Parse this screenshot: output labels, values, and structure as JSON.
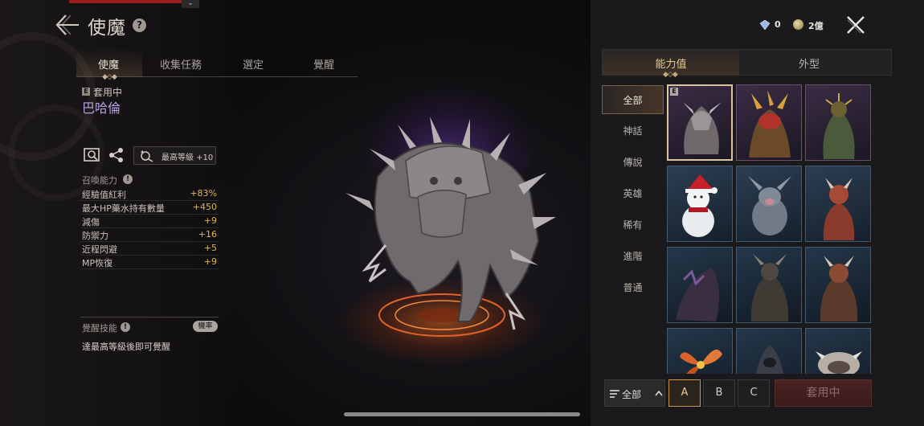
{
  "header": {
    "title": "使魔",
    "help_glyph": "?",
    "dropdown_glyph": "⌄"
  },
  "tabs": [
    {
      "label": "使魔",
      "active": true
    },
    {
      "label": "收集任務",
      "active": false
    },
    {
      "label": "選定",
      "active": false
    },
    {
      "label": "覺醒",
      "active": false
    }
  ],
  "current": {
    "badge": "E",
    "status": "套用中",
    "name": "巴哈倫",
    "level_label": "最高等級 +10"
  },
  "summon_stats": {
    "label": "召喚能力",
    "info_glyph": "!",
    "rows": [
      {
        "name": "經驗值紅利",
        "value": "+83%"
      },
      {
        "name": "最大HP藥水持有數量",
        "value": "+450"
      },
      {
        "name": "減傷",
        "value": "+9"
      },
      {
        "name": "防禦力",
        "value": "+16"
      },
      {
        "name": "近程閃避",
        "value": "+5"
      },
      {
        "name": "MP恢復",
        "value": "+9"
      }
    ]
  },
  "awaken": {
    "label": "覺醒技能",
    "info_glyph": "!",
    "prob_button": "機率",
    "note": "達最高等級後即可覺醒"
  },
  "currency": {
    "gems": "0",
    "gold": "2億"
  },
  "right_tabs": [
    {
      "label": "能力值",
      "active": true
    },
    {
      "label": "外型",
      "active": false
    }
  ],
  "categories": [
    {
      "label": "全部",
      "active": true
    },
    {
      "label": "神話",
      "active": false
    },
    {
      "label": "傳說",
      "active": false
    },
    {
      "label": "英雄",
      "active": false
    },
    {
      "label": "稀有",
      "active": false
    },
    {
      "label": "進階",
      "active": false
    },
    {
      "label": "普通",
      "active": false
    }
  ],
  "cards": [
    {
      "grade": "legend",
      "selected": true,
      "badge": "E",
      "icon": "armored-beast-icon"
    },
    {
      "grade": "legend",
      "selected": false,
      "badge": "",
      "icon": "fire-dragon-icon"
    },
    {
      "grade": "legend",
      "selected": false,
      "badge": "",
      "icon": "thorn-golem-icon"
    },
    {
      "grade": "hero",
      "selected": false,
      "badge": "",
      "icon": "snowman-icon"
    },
    {
      "grade": "hero",
      "selected": false,
      "badge": "",
      "icon": "winged-pig-icon"
    },
    {
      "grade": "hero",
      "selected": false,
      "badge": "",
      "icon": "red-imp-icon"
    },
    {
      "grade": "rare",
      "selected": false,
      "badge": "",
      "icon": "shadow-claw-icon"
    },
    {
      "grade": "rare",
      "selected": false,
      "badge": "",
      "icon": "dark-knight-icon"
    },
    {
      "grade": "rare",
      "selected": false,
      "badge": "",
      "icon": "red-ogre-icon"
    },
    {
      "grade": "rare",
      "selected": false,
      "badge": "",
      "icon": "fire-flower-icon"
    },
    {
      "grade": "rare",
      "selected": false,
      "badge": "",
      "icon": "hooded-figure-icon"
    },
    {
      "grade": "rare",
      "selected": false,
      "badge": "",
      "icon": "bone-beast-icon"
    }
  ],
  "bottom": {
    "filter_label": "全部",
    "grades": [
      {
        "label": "A",
        "active": true
      },
      {
        "label": "B",
        "active": false
      },
      {
        "label": "C",
        "active": false
      }
    ],
    "apply_label": "套用中"
  },
  "colors": {
    "accent_gold": "#e9c98e",
    "name_purple": "#b6a2e8",
    "stat_value": "#e0b55a"
  }
}
